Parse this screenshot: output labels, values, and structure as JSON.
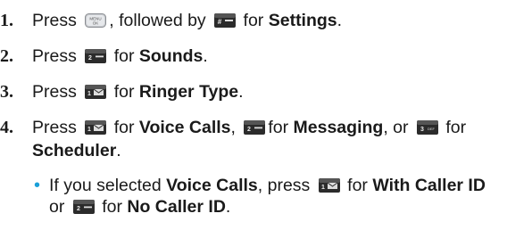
{
  "steps": [
    {
      "number": "1.",
      "pre": "Press",
      "key1": {
        "icon": "menu-ok-key",
        "label": "MENU OK"
      },
      "mid": ", followed by",
      "key2": {
        "icon": "hash-key",
        "label": "#"
      },
      "after": "for",
      "bold": "Settings",
      "end": "."
    },
    {
      "number": "2.",
      "pre": "Press",
      "key": {
        "icon": "key-2",
        "label": "2"
      },
      "after": "for",
      "bold": "Sounds",
      "end": "."
    },
    {
      "number": "3.",
      "pre": "Press",
      "key": {
        "icon": "key-1-messages",
        "label": "1"
      },
      "after": "for",
      "bold": "Ringer Type",
      "end": "."
    },
    {
      "number": "4.",
      "pre": "Press",
      "key1": {
        "icon": "key-1-messages",
        "label": "1"
      },
      "t1": "for",
      "b1": "Voice Calls",
      "sep1": ",",
      "key2": {
        "icon": "key-2",
        "label": "2"
      },
      "t2": "for",
      "b2": "Messaging",
      "sep2": ", or",
      "key3": {
        "icon": "key-3",
        "label": "3"
      },
      "t3": "for",
      "b3": "Scheduler",
      "end": "."
    }
  ],
  "bullet": {
    "pre": "If you selected",
    "b1": "Voice Calls",
    "t1": ", press",
    "key1": {
      "icon": "key-1-messages",
      "label": "1"
    },
    "t2": "for",
    "b2": "With Caller ID",
    "t3": "or",
    "key2": {
      "icon": "key-2",
      "label": "2"
    },
    "t4": "for",
    "b3": "No Caller ID",
    "end": "."
  },
  "colors": {
    "text": "#1a1a1a",
    "bullet": "#1a9fd8",
    "key_dark": "#2b2b2b",
    "key_green": "#3aa04a"
  }
}
